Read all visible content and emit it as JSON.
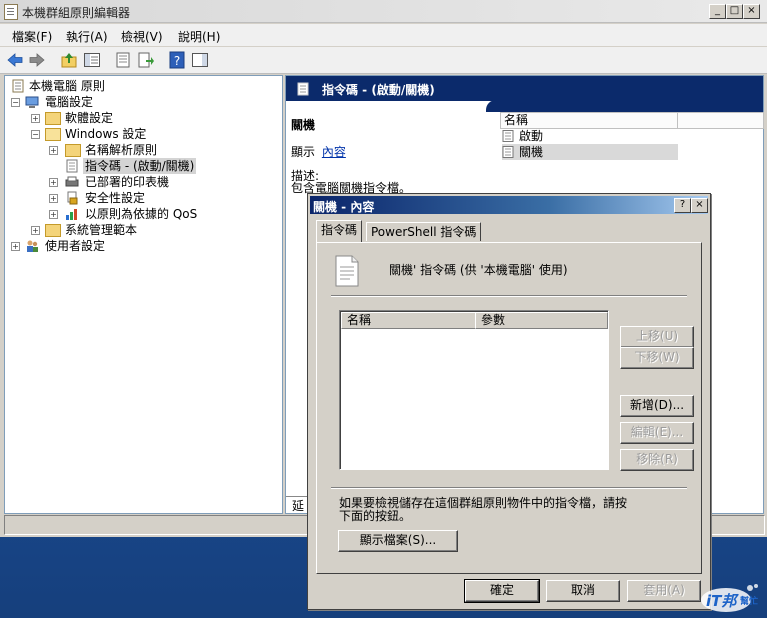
{
  "window": {
    "title": "本機群組原則編輯器",
    "controls": [
      "_",
      "□",
      "×"
    ]
  },
  "menu": [
    "檔案(F)",
    "執行(A)",
    "檢視(V)",
    "說明(H)"
  ],
  "toolbar_icons": [
    "back-arrow-icon",
    "forward-arrow-icon",
    "up-folder-icon",
    "show-hide-tree-icon",
    "properties-icon",
    "export-list-icon",
    "help-icon",
    "action-pane-icon"
  ],
  "tree": {
    "root": "本機電腦 原則",
    "computer_config": "電腦設定",
    "software_settings": "軟體設定",
    "windows_settings": "Windows 設定",
    "name_resolution_policy": "名稱解析原則",
    "scripts": "指令碼 - (啟動/關機)",
    "deployed_printers": "已部署的印表機",
    "security_settings": "安全性設定",
    "policy_qos": "以原則為依據的 QoS",
    "admin_templates": "系統管理範本",
    "user_config": "使用者設定"
  },
  "right_pane": {
    "header": "指令碼 - (啟動/關機)",
    "item_title": "關機",
    "display_prefix": "顯示",
    "display_link": "內容",
    "description_label": "描述:",
    "description_text": "包含電腦關機指令檔。",
    "column_name": "名稱",
    "items": [
      "啟動",
      "關機"
    ],
    "bottom_tab_partial": "延"
  },
  "dialog": {
    "title": "關機 - 內容",
    "title_controls": [
      "?",
      "×"
    ],
    "tabs": [
      "指令碼",
      "PowerShell 指令碼"
    ],
    "heading": "關機' 指令碼 (供 '本機電腦' 使用)",
    "list_columns": [
      "名稱",
      "參數"
    ],
    "side_buttons": {
      "move_up": "上移(U)",
      "move_down": "下移(W)",
      "add": "新增(D)...",
      "edit": "編輯(E)...",
      "remove": "移除(R)"
    },
    "info_text_1": "如果要檢視儲存在這個群組原則物件中的指令檔，請按",
    "info_text_2": "下面的按鈕。",
    "show_files": "顯示檔案(S)...",
    "ok": "確定",
    "cancel": "取消",
    "apply": "套用(A)"
  },
  "watermark": {
    "brand": "iT邦",
    "sub": "幫忙"
  }
}
